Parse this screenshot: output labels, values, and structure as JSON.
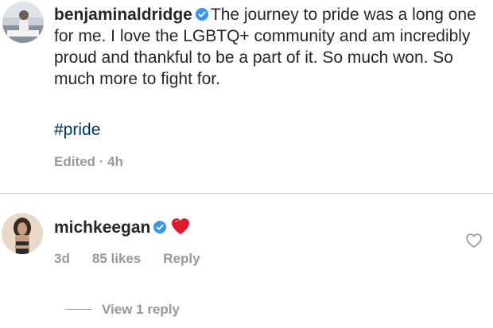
{
  "post": {
    "username": "benjaminaldridge",
    "caption": "The journey to pride was a long one for me. I love the LGBTQ+ community and am incredibly proud and thankful to be a part of it. So much won. So much more to fight for.",
    "hashtag": "#pride",
    "meta": "Edited · 4h"
  },
  "comment": {
    "username": "michkeegan",
    "time": "3d",
    "likes": "85 likes",
    "reply_label": "Reply",
    "view_replies": "View 1 reply",
    "emoji": "red-heart-emoji"
  },
  "icons": {
    "verified": "verified-badge-icon",
    "like": "heart-outline-icon"
  },
  "colors": {
    "text": "#262626",
    "secondary": "#999999",
    "hashtag": "#003569",
    "verified": "#3897f0",
    "heart": "#ed4956"
  }
}
